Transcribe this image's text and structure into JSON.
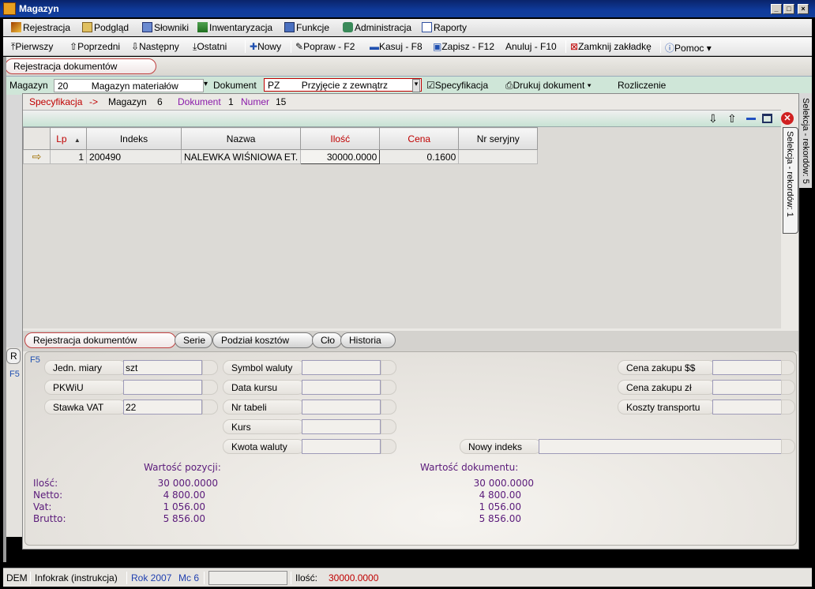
{
  "window": {
    "title": "Magazyn",
    "min": "_",
    "max": "□",
    "close": "×"
  },
  "menu": [
    "Rejestracja",
    "Podgląd",
    "Słowniki",
    "Inwentaryzacja",
    "Funkcje",
    "Administracja",
    "Raporty"
  ],
  "toolbar": {
    "first": "Pierwszy",
    "prev": "Poprzedni",
    "next": "Następny",
    "last": "Ostatni",
    "new": "Nowy",
    "edit": "Popraw - F2",
    "delete": "Kasuj - F8",
    "save": "Zapisz - F12",
    "cancel": "Anuluj - F10",
    "close_tab": "Zamknij zakładkę",
    "help": "Pomoc"
  },
  "main_tab": "Rejestracja dokumentów",
  "docbar": {
    "magazyn_label": "Magazyn",
    "magazyn_code": "20",
    "magazyn_name": "Magazyn materiałów",
    "dokument_label": "Dokument",
    "dokument_code": "PZ",
    "dokument_name": "Przyjęcie z zewnątrz",
    "spec": "Specyfikacja",
    "print": "Drukuj dokument",
    "settle": "Rozliczenie"
  },
  "breadcrumb": {
    "spec": "Specyfikacja",
    "arrow": "->",
    "magazyn": "Magazyn",
    "magazyn_no": "6",
    "dokument": "Dokument",
    "dokument_no": "1",
    "numer": "Numer",
    "numer_no": "15"
  },
  "grid": {
    "columns": [
      "Lp",
      "Indeks",
      "Nazwa",
      "Ilość",
      "Cena",
      "Nr seryjny"
    ],
    "sort_indicator": "▲",
    "rows": [
      {
        "lp": "1",
        "indeks": "200490",
        "nazwa": "NALEWKA WIŚNIOWA ET.",
        "ilosc": "30000.0000",
        "cena": "0.1600",
        "nr": ""
      }
    ]
  },
  "selection_tab": "Selekcja - rekordów: 1",
  "selection_tab_outer": "Selekcja - rekordów: 5",
  "left_tab_letter": "R",
  "bottom_tabs": [
    "Rejestracja dokumentów",
    "Serie",
    "Podział kosztów",
    "Cło",
    "Historia"
  ],
  "detail": {
    "f5": "F5",
    "jedn_label": "Jedn. miary",
    "jedn_val": "szt",
    "pkwiu_label": "PKWiU",
    "pkwiu_val": "",
    "vat_label": "Stawka VAT",
    "vat_val": "22",
    "symbol_label": "Symbol waluty",
    "data_label": "Data kursu",
    "tabela_label": "Nr tabeli",
    "kurs_label": "Kurs",
    "kwota_label": "Kwota waluty",
    "cena_usd_label": "Cena zakupu $$",
    "cena_zl_label": "Cena zakupu zł",
    "koszty_label": "Koszty transportu",
    "nowy_label": "Nowy indeks"
  },
  "summary": {
    "pos_title": "Wartość pozycji:",
    "doc_title": "Wartość dokumentu:",
    "labels": [
      "Ilość:",
      "Netto:",
      "Vat:",
      "Brutto:"
    ],
    "pos_values": [
      "30 000.0000",
      "4 800.00",
      "1 056.00",
      "5 856.00"
    ],
    "doc_values": [
      "30 000.0000",
      "4 800.00",
      "1 056.00",
      "5 856.00"
    ]
  },
  "status": {
    "dem": "DEM",
    "company": "Infokrak (instrukcja)",
    "rok": "Rok 2007",
    "mc": "Mc 6",
    "ilosc_label": "Ilość:",
    "ilosc_val": "30000.0000"
  },
  "colors": {
    "accent_red": "#c00000",
    "purple": "#5a1a7a",
    "title_blue": "#0a246a"
  }
}
